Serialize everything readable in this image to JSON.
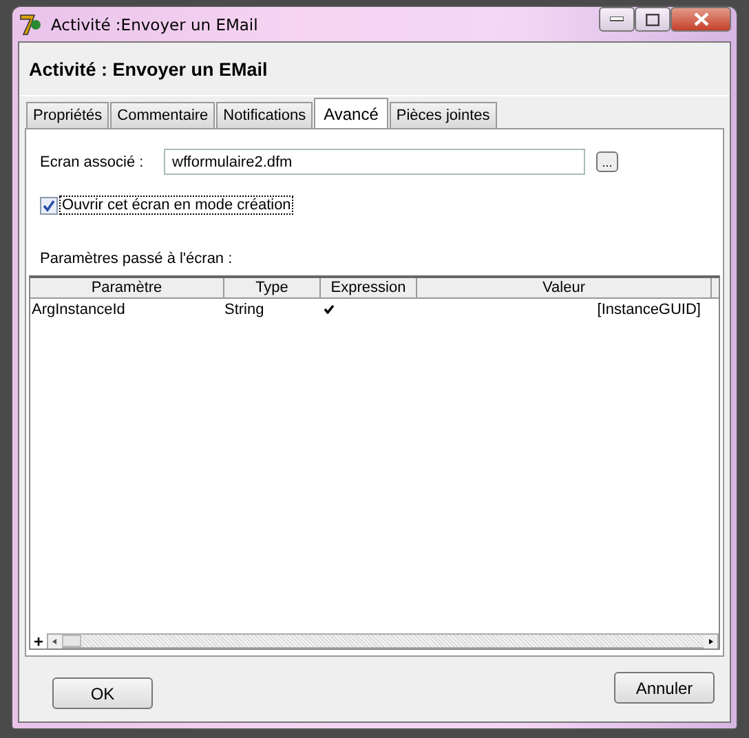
{
  "window": {
    "title": "Activité :Envoyer un EMail"
  },
  "header": "Activité : Envoyer un EMail",
  "tabs": [
    {
      "label": "Propriétés",
      "selected": false
    },
    {
      "label": "Commentaire",
      "selected": false
    },
    {
      "label": "Notifications",
      "selected": false
    },
    {
      "label": "Avancé",
      "selected": true
    },
    {
      "label": "Pièces jointes",
      "selected": false
    }
  ],
  "screen_field": {
    "label": "Ecran associé :",
    "value": "wfformulaire2.dfm",
    "browse_button": "..."
  },
  "design_mode": {
    "label": "Ouvrir cet écran en mode création",
    "checked": true
  },
  "params_label": "Paramètres passé à l'écran :",
  "table": {
    "columns": [
      "Paramètre",
      "Type",
      "Expression",
      "Valeur"
    ],
    "rows": [
      {
        "name": "ArgInstanceId",
        "type": "String",
        "expression": true,
        "value": "[InstanceGUID]"
      }
    ],
    "add_button": "+"
  },
  "buttons": {
    "ok": "OK",
    "cancel": "Annuler"
  }
}
